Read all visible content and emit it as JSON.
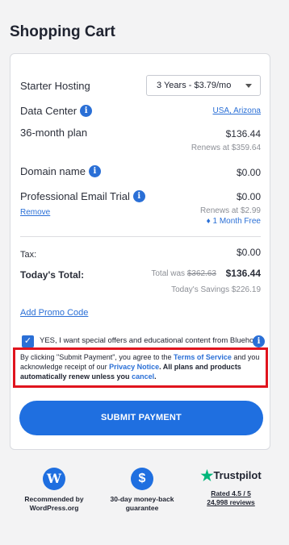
{
  "page": {
    "title": "Shopping Cart"
  },
  "cart": {
    "product": {
      "label": "Starter Hosting",
      "term_select_value": "3 Years - $3.79/mo"
    },
    "data_center": {
      "label": "Data Center",
      "value": "USA, Arizona"
    },
    "plan": {
      "label": "36-month plan",
      "price": "$136.44",
      "renews": "Renews at $359.64"
    },
    "domain": {
      "label": "Domain name",
      "price": "$0.00"
    },
    "email": {
      "label": "Professional Email Trial",
      "remove": "Remove",
      "price": "$0.00",
      "renews": "Renews at $2.99",
      "free_badge": "1 Month Free"
    },
    "tax": {
      "label": "Tax:",
      "value": "$0.00"
    },
    "total": {
      "label": "Today's Total:",
      "was_prefix": "Total was",
      "was_value": "$362.63",
      "value": "$136.44",
      "savings": "Today's Savings $226.19"
    },
    "promo_link": "Add Promo Code",
    "consent": {
      "checked": true,
      "text": "YES, I want special offers and educational content from Bluehost."
    },
    "notice": {
      "part1": "By clicking \"Submit Payment\", you agree to the",
      "tos": "Terms of Service",
      "part2": "and you acknowledge receipt of our",
      "privacy": "Privacy Notice",
      "part3": ". All plans and products automatically renew unless you",
      "cancel": "cancel",
      "part4": "."
    },
    "submit_label": "SUBMIT PAYMENT"
  },
  "badges": {
    "wordpress": {
      "line1": "Recommended by",
      "line2": "WordPress.org"
    },
    "moneyback": {
      "line1": "30-day money-back",
      "line2": "guarantee"
    },
    "trustpilot": {
      "brand": "Trustpilot",
      "rating": "Rated 4.5 / 5",
      "reviews": "24,998 reviews"
    }
  },
  "colors": {
    "accent": "#1f6fe0",
    "highlight_border": "#e0141e",
    "trustpilot_green": "#00b67a"
  }
}
